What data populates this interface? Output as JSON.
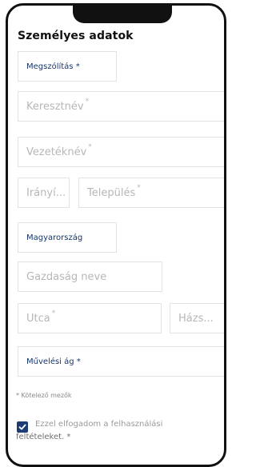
{
  "form": {
    "title": "Személyes adatok",
    "salutation": "Megszólítás *",
    "first_name": "Keresztnév",
    "last_name": "Vezetéknév",
    "zip": "Irányí...",
    "city": "Település",
    "country": "Magyarország",
    "farm_name": "Gazdaság neve",
    "street": "Utca",
    "house_no": "Házs...",
    "cultivation": "Művelési ág *",
    "required_note": "* Kötelező mezők",
    "terms_line1": "Ezzel elfogadom a felhasználási",
    "terms_line2": "feltételeket. *",
    "terms_checked": true,
    "required_mark": "*"
  },
  "colors": {
    "accent": "#1c3d73",
    "select_text": "#15356b",
    "placeholder": "#b7b7b7",
    "border": "#e3e3e3"
  }
}
